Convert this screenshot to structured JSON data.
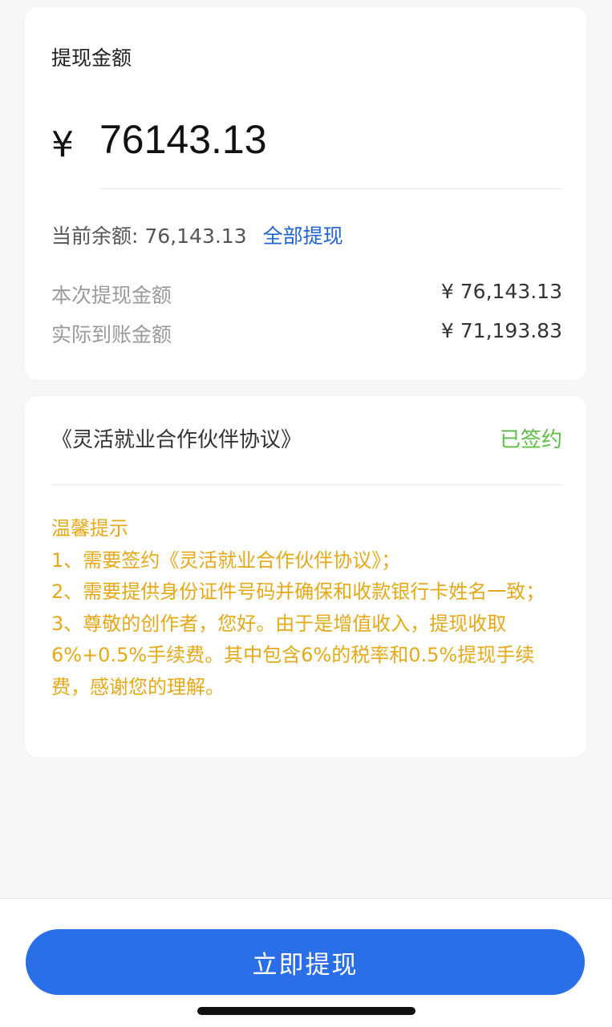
{
  "withdraw": {
    "title": "提现金额",
    "currency_symbol": "¥",
    "amount_value": "76143.13",
    "balance_text": "当前余额: 76,143.13",
    "withdraw_all_label": "全部提现",
    "this_withdrawal_label": "本次提现金额",
    "this_withdrawal_value": "¥ 76,143.13",
    "actual_received_label": "实际到账金额",
    "actual_received_value": "¥ 71,193.83"
  },
  "agreement": {
    "name": "《灵活就业合作伙伴协议》",
    "status": "已签约",
    "status_color": "#5cbf45"
  },
  "tips": {
    "heading": "温馨提示",
    "line1": "1、需要签约《灵活就业合作伙伴协议》；",
    "line2": "2、需要提供身份证件号码并确保和收款银行卡姓名一致；",
    "line3": "3、尊敬的创作者，您好。由于是增值收入，提现收取6%+0.5%手续费。其中包含6%的税率和0.5%提现手续费，感谢您的理解。",
    "color": "#e6a817"
  },
  "footer": {
    "submit_label": "立即提现",
    "accent_color": "#2a6ee8"
  }
}
